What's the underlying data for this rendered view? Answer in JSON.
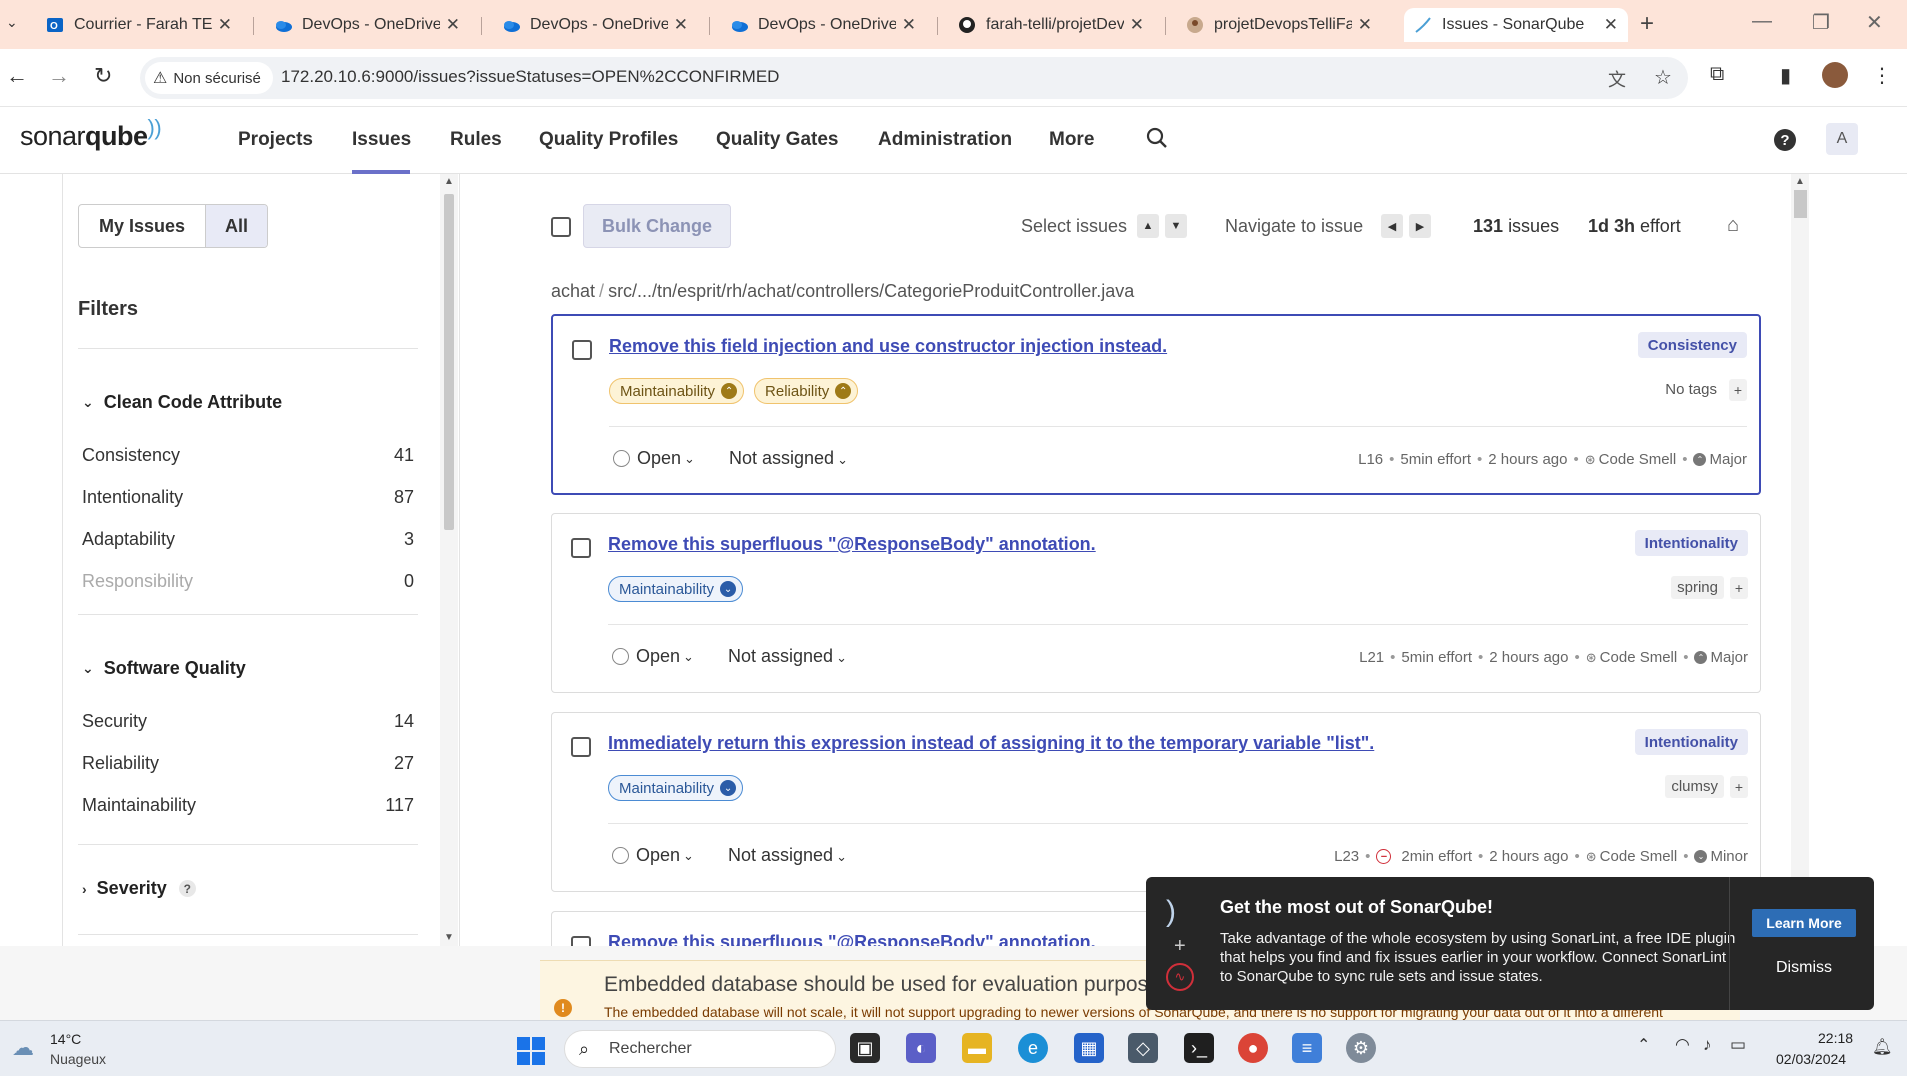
{
  "browser": {
    "tabs": [
      {
        "title": "Courrier - Farah TELLI",
        "icon": "outlook-icon"
      },
      {
        "title": "DevOps - OneDrive",
        "icon": "onedrive-icon"
      },
      {
        "title": "DevOps - OneDrive",
        "icon": "onedrive-icon"
      },
      {
        "title": "DevOps - OneDrive",
        "icon": "onedrive-icon"
      },
      {
        "title": "farah-telli/projetDev",
        "icon": "github-icon"
      },
      {
        "title": "projetDevopsTelliFar",
        "icon": "avatar-icon"
      },
      {
        "title": "Issues - SonarQube",
        "icon": "sonarqube-icon",
        "active": true
      }
    ],
    "security_label": "Non sécurisé",
    "url": "172.20.10.6:9000/issues?issueStatuses=OPEN%2CCONFIRMED"
  },
  "app": {
    "logo_light": "sonar",
    "logo_bold": "qube",
    "nav": [
      "Projects",
      "Issues",
      "Rules",
      "Quality Profiles",
      "Quality Gates",
      "Administration",
      "More"
    ],
    "active_nav": "Issues",
    "help": "?",
    "avatar": "A"
  },
  "sidebar": {
    "toggle": {
      "my": "My Issues",
      "all": "All"
    },
    "filters_title": "Filters",
    "clean_code": {
      "title": "Clean Code Attribute",
      "items": [
        {
          "label": "Consistency",
          "count": "41"
        },
        {
          "label": "Intentionality",
          "count": "87"
        },
        {
          "label": "Adaptability",
          "count": "3"
        },
        {
          "label": "Responsibility",
          "count": "0"
        }
      ]
    },
    "software_quality": {
      "title": "Software Quality",
      "items": [
        {
          "label": "Security",
          "count": "14"
        },
        {
          "label": "Reliability",
          "count": "27"
        },
        {
          "label": "Maintainability",
          "count": "117"
        }
      ]
    },
    "severity": {
      "title": "Severity",
      "help": "?"
    }
  },
  "toolbar": {
    "bulk": "Bulk Change",
    "select_issues": "Select issues",
    "navigate": "Navigate to issue",
    "count": "131",
    "count_label": "issues",
    "effort": "1d 3h",
    "effort_label": "effort"
  },
  "file": {
    "project": "achat",
    "path": "src/.../tn/esprit/rh/achat/controllers/CategorieProduitController.java"
  },
  "issues": [
    {
      "title": "Remove this field injection and use constructor injection instead.",
      "attribute": "Consistency",
      "qualities": [
        "Maintainability",
        "Reliability"
      ],
      "quality_style": "warn",
      "tags": "No tags",
      "status": "Open",
      "assignee": "Not assigned",
      "line": "L16",
      "effort": "5min effort",
      "age": "2 hours ago",
      "type": "Code Smell",
      "severity": "Major"
    },
    {
      "title": "Remove this superfluous \"@ResponseBody\" annotation.",
      "attribute": "Intentionality",
      "qualities": [
        "Maintainability"
      ],
      "quality_style": "info",
      "tags": "spring",
      "status": "Open",
      "assignee": "Not assigned",
      "line": "L21",
      "effort": "5min effort",
      "age": "2 hours ago",
      "type": "Code Smell",
      "severity": "Major"
    },
    {
      "title": "Immediately return this expression instead of assigning it to the temporary variable \"list\".",
      "attribute": "Intentionality",
      "qualities": [
        "Maintainability"
      ],
      "quality_style": "info",
      "tags": "clumsy",
      "status": "Open",
      "assignee": "Not assigned",
      "line": "L23",
      "effort": "2min effort",
      "age": "2 hours ago",
      "type": "Code Smell",
      "severity": "Minor"
    },
    {
      "title": "Remove this superfluous \"@ResponseBody\" annotation."
    }
  ],
  "db_warning": {
    "title": "Embedded database should be used for evaluation purposes only",
    "text": "The embedded database will not scale, it will not support upgrading to newer versions of SonarQube, and there is no support for migrating your data out of it into a different"
  },
  "popup": {
    "title": "Get the most out of SonarQube!",
    "text": "Take advantage of the whole ecosystem by using SonarLint, a free IDE plugin that helps you find and fix issues earlier in your workflow. Connect SonarLint to SonarQube to sync rule sets and issue states.",
    "learn_more": "Learn More",
    "dismiss": "Dismiss"
  },
  "taskbar": {
    "temp": "14°C",
    "condition": "Nuageux",
    "search": "Rechercher",
    "time": "22:18",
    "date": "02/03/2024"
  }
}
